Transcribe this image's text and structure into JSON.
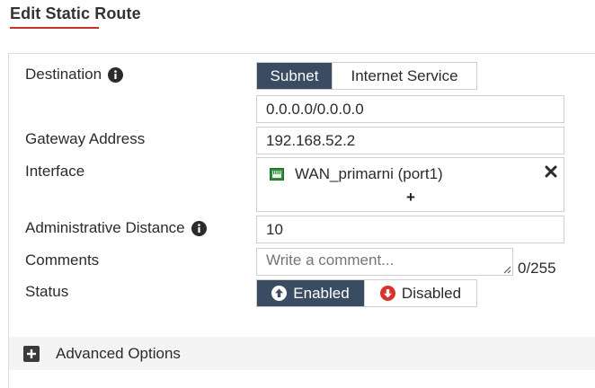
{
  "page": {
    "title": "Edit Static Route"
  },
  "colors": {
    "accent": "#c9302c",
    "toggle_active": "#3a4c62",
    "disabled_icon": "#d9342b",
    "port_icon": "#2e8b3a"
  },
  "destination": {
    "label": "Destination",
    "options": [
      "Subnet",
      "Internet Service"
    ],
    "selected": "Subnet",
    "value": "0.0.0.0/0.0.0.0"
  },
  "gateway": {
    "label": "Gateway Address",
    "value": "192.168.52.2"
  },
  "interface": {
    "label": "Interface",
    "selected": "WAN_primarni (port1)",
    "add_symbol": "+"
  },
  "admin_distance": {
    "label": "Administrative Distance",
    "value": "10"
  },
  "comments": {
    "label": "Comments",
    "placeholder": "Write a comment...",
    "counter": "0/255"
  },
  "status": {
    "label": "Status",
    "enabled_label": "Enabled",
    "disabled_label": "Disabled",
    "selected": "Enabled"
  },
  "advanced": {
    "label": "Advanced Options"
  }
}
